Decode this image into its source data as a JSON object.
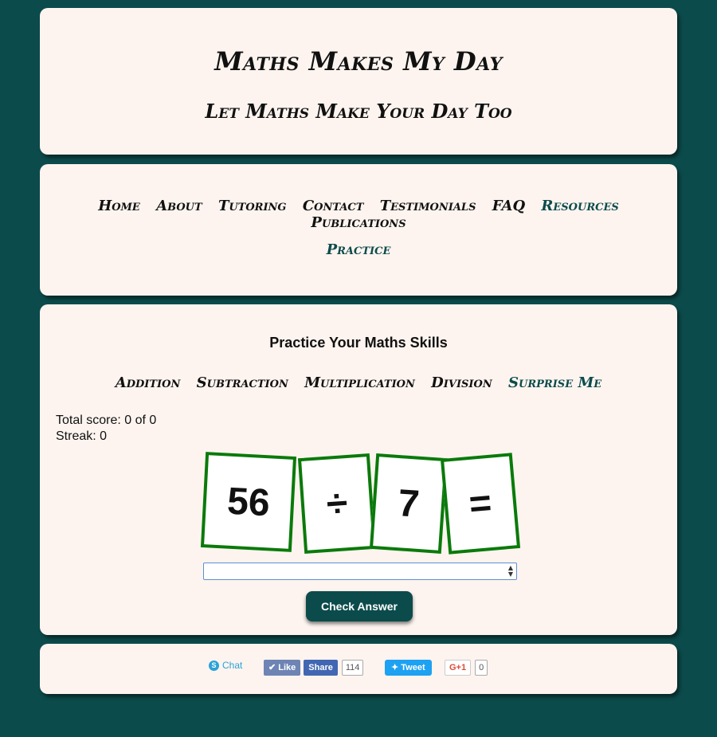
{
  "header": {
    "title": "Maths Makes My Day",
    "subtitle": "Let Maths Make Your Day Too"
  },
  "nav": {
    "items": [
      "Home",
      "About",
      "Tutoring",
      "Contact",
      "Testimonials",
      "FAQ",
      "Resources",
      "Publications"
    ],
    "active": "Resources",
    "sub_item": "Practice"
  },
  "practice": {
    "title": "Practice Your Maths Skills",
    "operations": [
      "Addition",
      "Subtraction",
      "Multiplication",
      "Division",
      "Surprise Me"
    ],
    "active_operation": "Surprise Me",
    "score_label": "Total score: 0 of 0",
    "streak_label": "Streak: 0",
    "cards": [
      "56",
      "÷",
      "7",
      "="
    ],
    "answer_value": "",
    "check_label": "Check Answer"
  },
  "social": {
    "skype": "Chat",
    "like": "Like",
    "share": "Share",
    "share_count": "114",
    "tweet": "Tweet",
    "gplus": "G+1",
    "gplus_count": "0"
  },
  "colors": {
    "background": "#0c4b4b",
    "panel": "#fdf4ef",
    "card_border": "#0a7a0a",
    "accent": "#0c4b4b"
  }
}
